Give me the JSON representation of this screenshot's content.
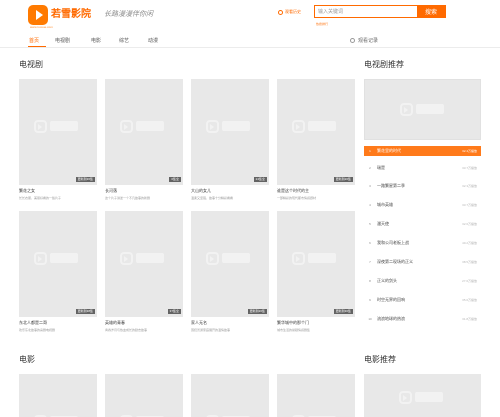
{
  "header": {
    "logo_text": "若雪影院",
    "logo_subtitle": "www.ruoxue.com",
    "slogan": "长路漫漫伴你闲",
    "history": "观看历史",
    "search_placeholder": "输入关键词",
    "search_button": "搜索",
    "hot_link": "热搜排行"
  },
  "nav": {
    "items": [
      {
        "label": "首页",
        "active": true
      },
      {
        "label": "电视剧",
        "active": false
      },
      {
        "label": "电影",
        "active": false
      },
      {
        "label": "综艺",
        "active": false
      },
      {
        "label": "动漫",
        "active": false
      }
    ],
    "watch_history": "观看记录"
  },
  "sections": {
    "tv_title": "电视剧",
    "tv_recommend_title": "电视剧推荐",
    "movie_title": "电影",
    "movie_recommend_title": "电影推荐"
  },
  "tv_cards": [
    {
      "title": "繁花之女",
      "desc": "长长衣服，美丽好看的一些片子",
      "badge": "更新到36集"
    },
    {
      "title": "长河落",
      "desc": "这个片子讲述一个不凡故事的新剧",
      "badge": "0集全"
    },
    {
      "title": "大山的女儿",
      "desc": "温柔又坚强，故事十分精彩看看",
      "badge": "24集全"
    },
    {
      "title": "谁是这个时代的主",
      "desc": "一部精彩的现代都市情感题材",
      "badge": "更新到20集"
    },
    {
      "title": "东北人都是二哥",
      "desc": "欢乐东北故事的喜剧电视剧",
      "badge": "更新到38集"
    },
    {
      "title": "英雄的青春",
      "desc": "青春岁月与热血成长的励志故事",
      "badge": "37集全"
    },
    {
      "title": "家人无名",
      "desc": "围绕普通家庭展开的温情故事",
      "badge": "更新到20集"
    },
    {
      "title": "繁华城中的那个门",
      "desc": "城市生活的悬疑情感剧集",
      "badge": "更新到30集"
    }
  ],
  "rankings": [
    {
      "num": "1",
      "title": "繁花里的时代",
      "meta": "32.4万播放"
    },
    {
      "num": "2",
      "title": "瑞是",
      "meta": "33.7万播放"
    },
    {
      "num": "3",
      "title": "一路繁星第二季",
      "meta": "32.3万播放"
    },
    {
      "num": "4",
      "title": "城市英雄",
      "meta": "33.7万播放"
    },
    {
      "num": "5",
      "title": "潘天使",
      "meta": "32.6万播放"
    },
    {
      "num": "6",
      "title": "我和公司老板上战",
      "meta": "40.2万播放"
    },
    {
      "num": "7",
      "title": "深夜第二现场的正义",
      "meta": "38.5万播放"
    },
    {
      "num": "8",
      "title": "正义的剑头",
      "meta": "27.6万播放"
    },
    {
      "num": "9",
      "title": "时空无界的回响",
      "meta": "35.0万播放"
    },
    {
      "num": "10",
      "title": "流浪地球的热浪",
      "meta": "31.8万播放"
    }
  ]
}
